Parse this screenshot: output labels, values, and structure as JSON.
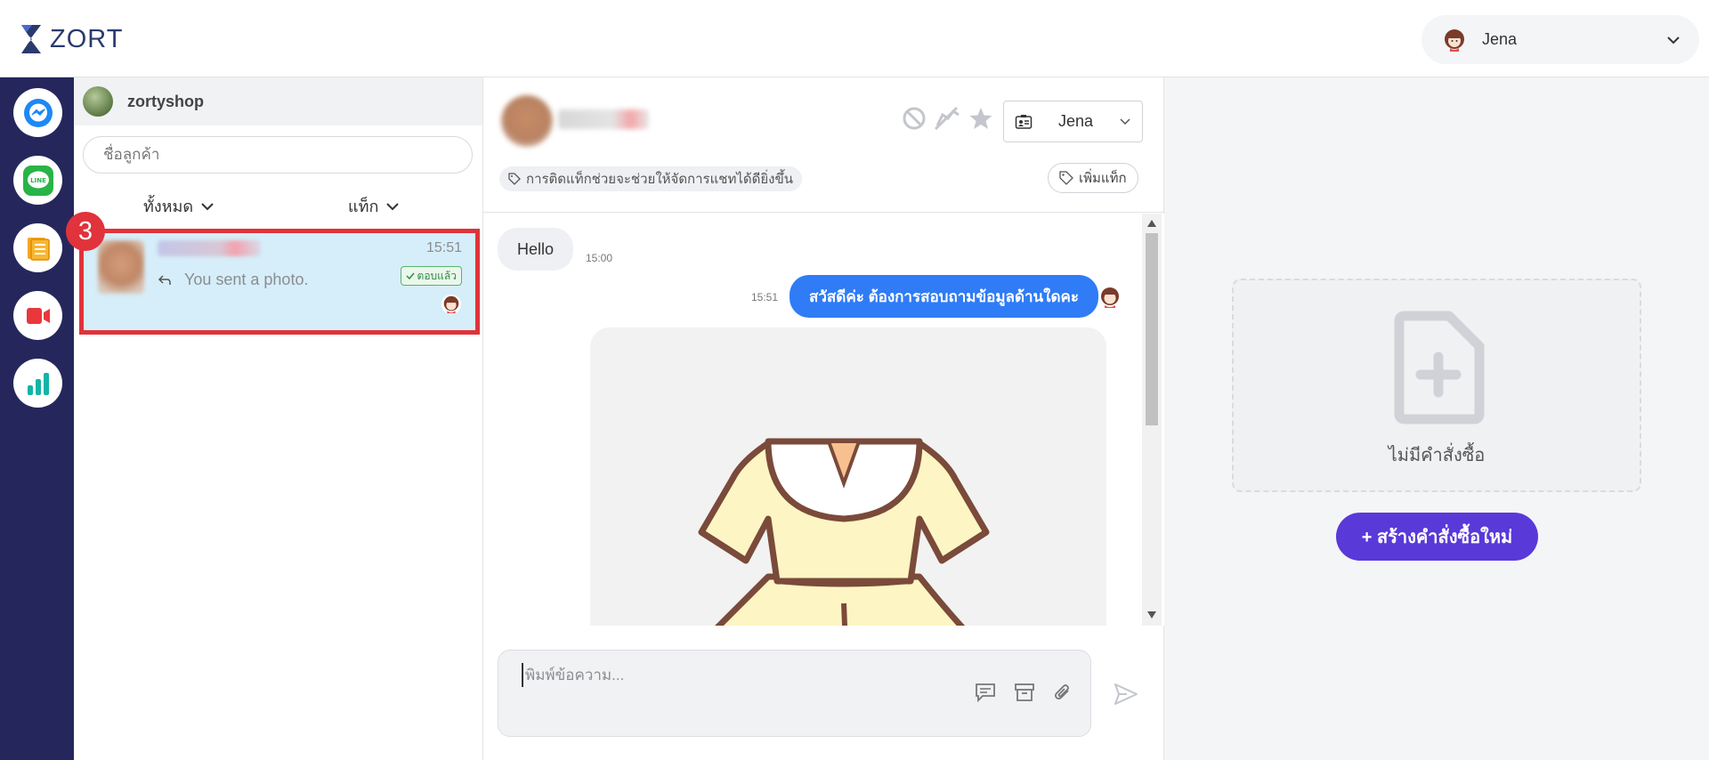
{
  "app": {
    "logo_text": "ZORT"
  },
  "user_menu": {
    "name": "Jena"
  },
  "rail": {
    "items": [
      "messenger-icon",
      "line-icon",
      "orders-icon",
      "live-video-icon",
      "analytics-icon"
    ]
  },
  "conversation_list": {
    "shop_name": "zortyshop",
    "search_placeholder": "ชื่อลูกค้า",
    "filter_all": "ทั้งหมด",
    "filter_tag": "แท็ก",
    "items": [
      {
        "time": "15:51",
        "last_message": "You sent a photo.",
        "status": "ตอบแล้ว"
      }
    ],
    "annotation_number": "3"
  },
  "chat": {
    "assignee": "Jena",
    "tag_hint": "การติดแท็กช่วยจะช่วยให้จัดการแชทได้ดียิ่งขึ้น",
    "add_tag": "เพิ่มแท็ก",
    "messages": [
      {
        "direction": "in",
        "text": "Hello",
        "time": "15:00"
      },
      {
        "direction": "out",
        "text": "สวัสดีค่ะ ต้องการสอบถามข้อมูลด้านใดคะ",
        "time": "15:51"
      }
    ],
    "composer_placeholder": "พิมพ์ข้อความ..."
  },
  "orders": {
    "empty_label": "ไม่มีคำสั่งซื้อ",
    "create_button": "+ สร้างคำสั่งซื้อใหม่"
  },
  "colors": {
    "rail_bg": "#25275c",
    "accent_blue": "#2f7cf6",
    "create_purple": "#5939d8",
    "highlight_red": "#e0333b",
    "selected_row": "#d6eef9"
  }
}
